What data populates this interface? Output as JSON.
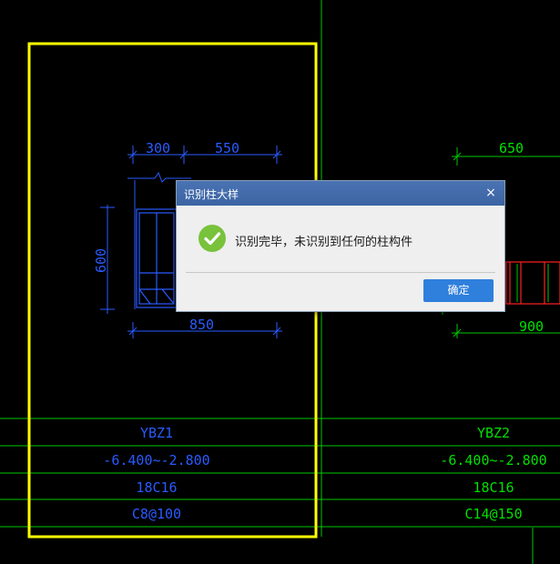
{
  "dialog": {
    "title": "识别柱大样",
    "close_glyph": "×",
    "message": "识别完毕，未识别到任何的柱构件",
    "ok_label": "确定",
    "icon": "check-circle-icon"
  },
  "drawing": {
    "detail_left": {
      "dim_top_a": "300",
      "dim_top_b": "550",
      "dim_left": "600",
      "dim_bottom": "850"
    },
    "detail_right": {
      "dim_top": "650",
      "dim_bottom": "900"
    },
    "table": {
      "col1": [
        "YBZ1",
        "-6.400~-2.800",
        "18C16",
        "C8@100"
      ],
      "col2": [
        "YBZ2",
        "-6.400~-2.800",
        "18C16",
        "C14@150"
      ]
    }
  },
  "colors": {
    "background": "#000000",
    "frame": "#ffff00",
    "grid": "#00c800",
    "dimension": "#2a5bff",
    "table_text": "#00e000",
    "rebar": "#ff2020",
    "dialog_title": "#3f68a8",
    "ok_button": "#2f7fdc",
    "success_icon": "#78c23c"
  }
}
